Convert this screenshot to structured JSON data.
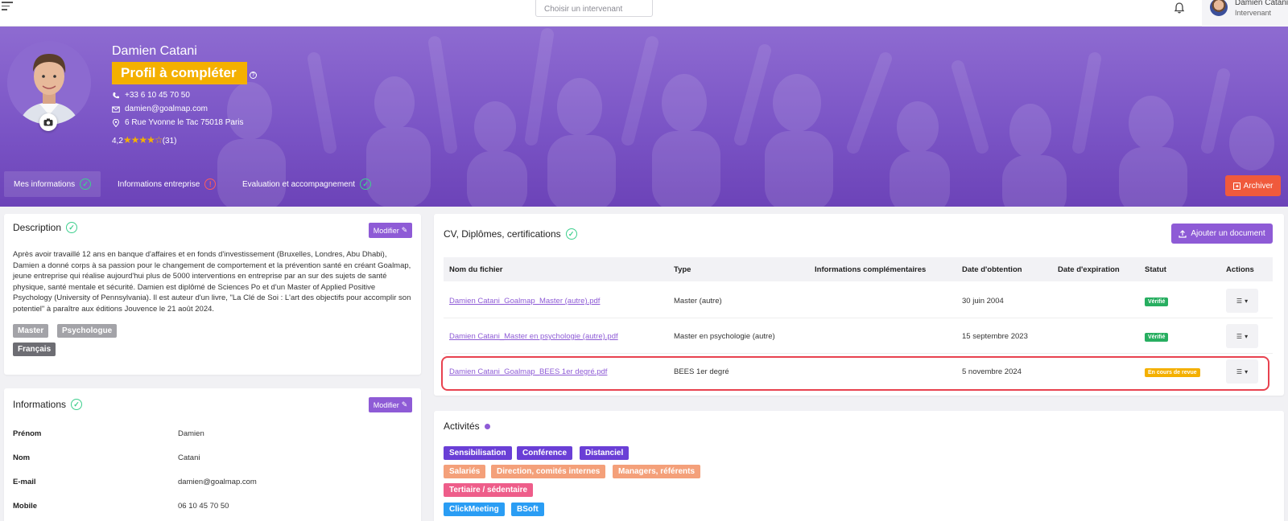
{
  "topbar": {
    "picker_placeholder": "Choisir un intervenant",
    "user_name": "Damien Catani",
    "user_role": "Intervenant"
  },
  "profile": {
    "name": "Damien Catani",
    "status_badge": "Profil à compléter",
    "phone": "+33 6 10 45 70 50",
    "email": "damien@goalmap.com",
    "address": "6 Rue Yvonne le Tac 75018 Paris",
    "rating": "4,2",
    "stars": "★★★★☆",
    "review_count": "(31)"
  },
  "tabs": [
    {
      "label": "Mes informations",
      "state": "ok"
    },
    {
      "label": "Informations entreprise",
      "state": "error"
    },
    {
      "label": "Evaluation et accompagnement",
      "state": "ok"
    }
  ],
  "archive_label": "Archiver",
  "description": {
    "title": "Description",
    "edit_label": "Modifier",
    "text": "Après avoir travaillé 12 ans en banque d'affaires et en fonds d'investissement (Bruxelles, Londres, Abu Dhabi), Damien a donné corps à sa passion pour le changement de comportement et la prévention santé en créant Goalmap, jeune entreprise qui réalise aujourd'hui plus de 5000 interventions en entreprise par an sur des sujets de santé physique, santé mentale et sécurité. Damien est diplômé de Sciences Po et d'un Master of Applied Positive Psychology (University of Pennsylvania). Il est auteur d'un livre, \"La Clé de Soi : L'art des objectifs pour accomplir son potentiel\" à paraître aux éditions Jouvence le 21 août 2024.",
    "tags": [
      "Master",
      "Psychologue",
      "Français"
    ]
  },
  "informations": {
    "title": "Informations",
    "edit_label": "Modifier",
    "rows": [
      {
        "label": "Prénom",
        "value": "Damien"
      },
      {
        "label": "Nom",
        "value": "Catani"
      },
      {
        "label": "E-mail",
        "value": "damien@goalmap.com"
      },
      {
        "label": "Mobile",
        "value": "06 10 45 70 50"
      }
    ]
  },
  "documents": {
    "title": "CV, Diplômes, certifications",
    "add_label": "Ajouter un document",
    "columns": [
      "Nom du fichier",
      "Type",
      "Informations complémentaires",
      "Date d'obtention",
      "Date d'expiration",
      "Statut",
      "Actions"
    ],
    "rows": [
      {
        "file": "Damien Catani_Goalmap_Master (autre).pdf",
        "type": "Master (autre)",
        "info": "",
        "obtained": "30 juin 2004",
        "expires": "",
        "status": "Vérifié",
        "status_color": "#27ae60"
      },
      {
        "file": "Damien Catani_Master en psychologie (autre).pdf",
        "type": "Master en psychologie (autre)",
        "info": "",
        "obtained": "15 septembre 2023",
        "expires": "",
        "status": "Vérifié",
        "status_color": "#27ae60"
      },
      {
        "file": "Damien Catani_Goalmap_BEES 1er degré.pdf",
        "type": "BEES 1er degré",
        "info": "",
        "obtained": "5 novembre 2024",
        "expires": "",
        "status": "En cours de revue",
        "status_color": "#f4b000"
      }
    ]
  },
  "activites": {
    "title": "Activités",
    "tags_row1": [
      "Sensibilisation",
      "Conférence",
      "Distanciel"
    ],
    "tags_row2": [
      "Salariés",
      "Direction, comités internes",
      "Managers, référents"
    ],
    "tags_row3": [
      "Tertiaire / sédentaire"
    ],
    "tags_row4": [
      "ClickMeeting",
      "BSoft"
    ],
    "colors": {
      "purple": "#6a3fd6",
      "salmon": "#f4a07a",
      "pink": "#ee5d8a",
      "blue": "#2a9df4"
    }
  },
  "colors": {
    "accent": "#8e5bd6",
    "warning": "#f4b000",
    "danger": "#f05a3c",
    "ok": "#3ecf8e"
  }
}
